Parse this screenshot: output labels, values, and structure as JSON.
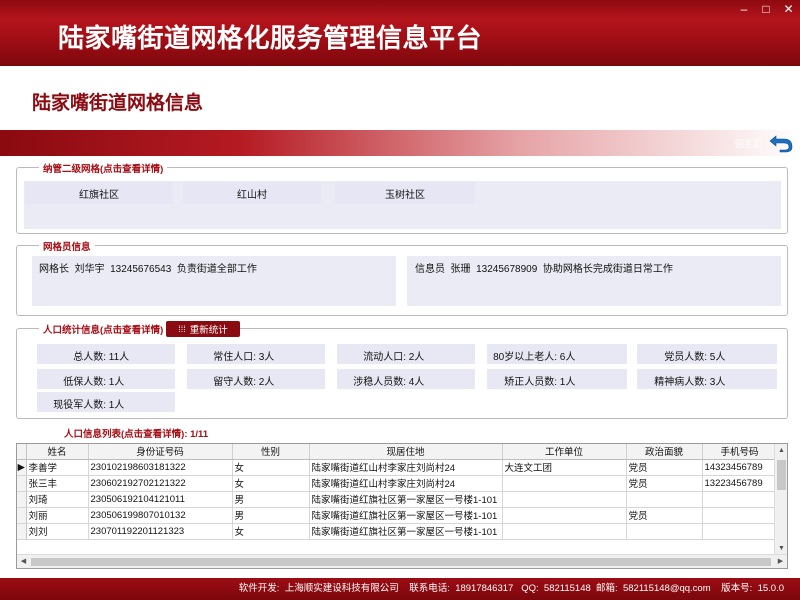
{
  "app": {
    "title": "陆家嘴街道网格化服务管理信息平台",
    "window_buttons": [
      "–",
      "□",
      "✕"
    ]
  },
  "page": {
    "heading": "陆家嘴街道网格信息",
    "home_label": "回主页"
  },
  "grids": {
    "title": "纳管二级网格(点击查看详情)",
    "items": [
      "红旗社区",
      "红山村",
      "玉树社区"
    ]
  },
  "staff": {
    "title": "网格员信息",
    "leader": "网格长  刘华宇  13245676543  负责街道全部工作",
    "info": "信息员  张珊  13245678909  协助网格长完成街道日常工作"
  },
  "stats": {
    "title": "人口统计信息(点击查看详情)",
    "recount_label": "重新统计",
    "items": [
      {
        "label": "总人数:",
        "value": "11人"
      },
      {
        "label": "常住人口:",
        "value": "3人"
      },
      {
        "label": "流动人口:",
        "value": "2人"
      },
      {
        "label": "80岁以上老人:",
        "value": "6人"
      },
      {
        "label": "党员人数:",
        "value": "5人"
      },
      {
        "label": "低保人数:",
        "value": "1人"
      },
      {
        "label": "留守人数:",
        "value": "2人"
      },
      {
        "label": "涉稳人员数:",
        "value": "4人"
      },
      {
        "label": "矫正人员数:",
        "value": "1人"
      },
      {
        "label": "精神病人数:",
        "value": "3人"
      },
      {
        "label": "现役军人数:",
        "value": "1人"
      }
    ]
  },
  "population": {
    "title": "人口信息列表(点击查看详情):  1/11",
    "columns": [
      "姓名",
      "身份证号码",
      "性别",
      "现居住地",
      "工作单位",
      "政治面貌",
      "手机号码"
    ],
    "rows": [
      [
        "李善学",
        "230102198603181322",
        "女",
        "陆家嘴街道红山村李家庄刘尚村24",
        "大连文工团",
        "党员",
        "14323456789"
      ],
      [
        "张三丰",
        "230602192702121322",
        "女",
        "陆家嘴街道红山村李家庄刘尚村24",
        "",
        "党员",
        "13223456789"
      ],
      [
        "刘琦",
        "230506192104121011",
        "男",
        "陆家嘴街道红旗社区第一家屋区一号楼1-101",
        "",
        "",
        ""
      ],
      [
        "刘丽",
        "230506199807010132",
        "男",
        "陆家嘴街道红旗社区第一家屋区一号楼1-101",
        "",
        "党员",
        ""
      ],
      [
        "刘刘",
        "230701192201121323",
        "女",
        "陆家嘴街道红旗社区第一家屋区一号楼1-101",
        "",
        "",
        ""
      ]
    ],
    "selected_row": 0
  },
  "footer": {
    "text": "软件开发:  上海顺实建设科技有限公司    联系电话:  18917846317   QQ:  582115148  邮箱:  582115148@qq.com    版本号:  15.0.0"
  },
  "colors": {
    "brand_red": "#a50e16",
    "panel_bg": "#e6e6f4"
  }
}
